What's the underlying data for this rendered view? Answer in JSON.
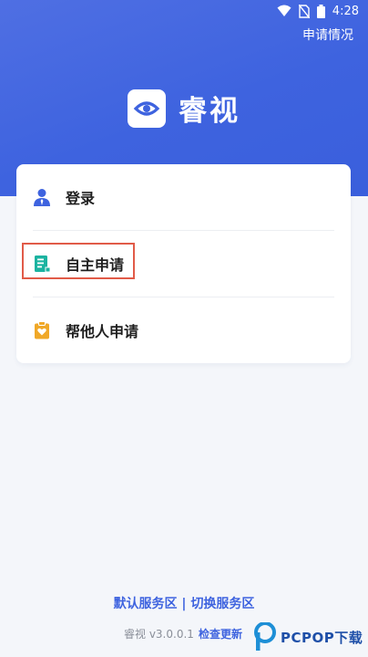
{
  "status_bar": {
    "time": "4:28"
  },
  "header": {
    "apply_status_link": "申请情况",
    "app_name": "睿视"
  },
  "menu": {
    "items": [
      {
        "label": "登录",
        "icon": "user-icon"
      },
      {
        "label": "自主申请",
        "icon": "form-icon",
        "highlighted": true
      },
      {
        "label": "帮他人申请",
        "icon": "clipboard-heart-icon"
      }
    ]
  },
  "footer": {
    "default_zone": "默认服务区",
    "separator": " | ",
    "switch_zone": "切换服务区",
    "version": "睿视 v3.0.0.1",
    "check_update": "检查更新"
  },
  "watermark": {
    "text": "PCPOP下载"
  },
  "colors": {
    "brand_blue": "#3e63df",
    "teal": "#1bb3a0",
    "orange": "#f0a828",
    "highlight_red": "#e15b48"
  }
}
